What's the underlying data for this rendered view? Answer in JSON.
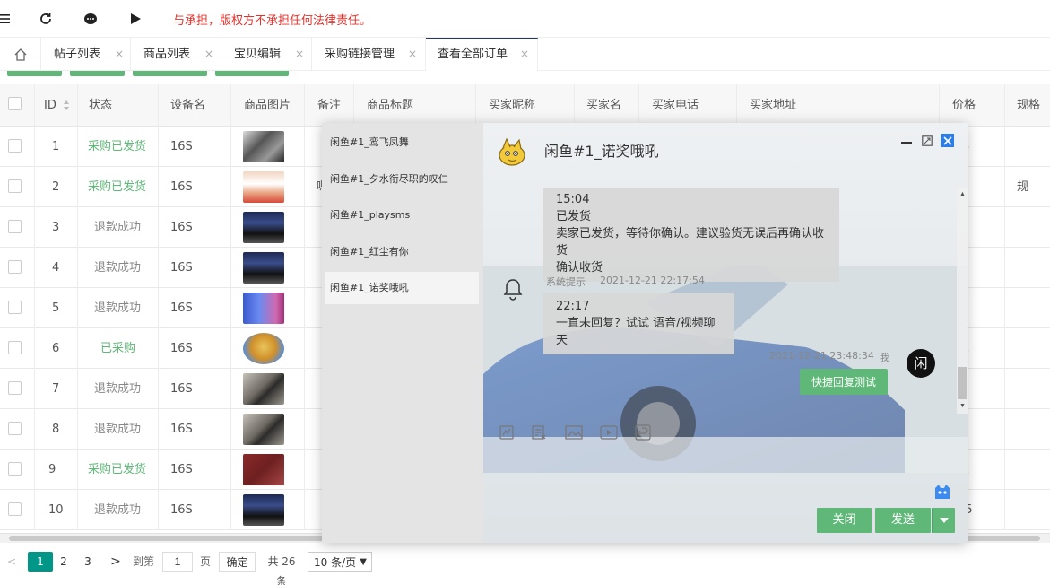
{
  "topbar": {
    "notice": "与承担，版权方不承担任何法律责任。"
  },
  "tabs": {
    "items": [
      {
        "label": "帖子列表"
      },
      {
        "label": "商品列表"
      },
      {
        "label": "宝贝编辑"
      },
      {
        "label": "采购链接管理"
      },
      {
        "label": "查看全部订单"
      }
    ],
    "close_glyph": "×"
  },
  "table": {
    "headers": [
      "ID",
      "状态",
      "设备名",
      "商品图片",
      "备注",
      "商品标题",
      "买家昵称",
      "买家名",
      "买家电话",
      "买家地址",
      "价格",
      "规格"
    ],
    "rows": [
      {
        "id": "1",
        "status": "采购已发货",
        "device": "16S",
        "price": "3",
        "spec": ""
      },
      {
        "id": "2",
        "status": "采购已发货",
        "device": "16S",
        "note": "嗯",
        "price": "",
        "spec": "规格:U"
      },
      {
        "id": "3",
        "status": "退款成功",
        "device": "16S",
        "price": "",
        "spec": ""
      },
      {
        "id": "4",
        "status": "退款成功",
        "device": "16S",
        "price": "",
        "spec": ""
      },
      {
        "id": "5",
        "status": "退款成功",
        "device": "16S",
        "price": "",
        "spec": ""
      },
      {
        "id": "6",
        "status": "已采购",
        "device": "16S",
        "price": "1",
        "spec": ""
      },
      {
        "id": "7",
        "status": "退款成功",
        "device": "16S",
        "price": "",
        "spec": ""
      },
      {
        "id": "8",
        "status": "退款成功",
        "device": "16S",
        "price": "",
        "spec": ""
      },
      {
        "id": "9",
        "status": "采购已发货",
        "device": "16S",
        "price": "1",
        "spec": ""
      },
      {
        "id": "10",
        "status": "退款成功",
        "device": "16S",
        "price": "45",
        "spec": ""
      }
    ]
  },
  "pager": {
    "prev": "<",
    "pages": [
      "1",
      "2",
      "3"
    ],
    "next": ">",
    "goto_label": "到第",
    "goto_value": "1",
    "page_unit": "页",
    "confirm": "确定",
    "total": "共 26 条",
    "per_page": "10 条/页"
  },
  "chat": {
    "contacts": [
      {
        "label": "闲鱼#1_鸾飞凤舞"
      },
      {
        "label": "闲鱼#1_夕水衔尽职的叹仁"
      },
      {
        "label": "闲鱼#1_playsms"
      },
      {
        "label": "闲鱼#1_红尘有你"
      },
      {
        "label": "闲鱼#1_诺奖哦吼"
      }
    ],
    "title": "闲鱼#1_诺奖哦吼",
    "messages": {
      "m1_line1": "15:04",
      "m1_line2": "已发货",
      "m1_line3": "卖家已发货，等待你确认。建议验货无误后再确认收货",
      "m1_line4": "确认收货",
      "m2_sender": "系统提示",
      "m2_time": "2021-12-21 22:17:54",
      "m2_line1": "22:17",
      "m2_line2": "一直未回复？试试 语音/视频聊天",
      "m3_time": "2021-12-21 23:48:34",
      "m3_sender": "我",
      "m3_avatar": "闲",
      "m3_text": "快捷回复测试"
    },
    "buttons": {
      "close": "关闭",
      "send": "发送"
    }
  },
  "colors": {
    "accent_green": "#5fb878",
    "notice_red": "#e2322c",
    "tab_active_border": "#2a3a55"
  }
}
